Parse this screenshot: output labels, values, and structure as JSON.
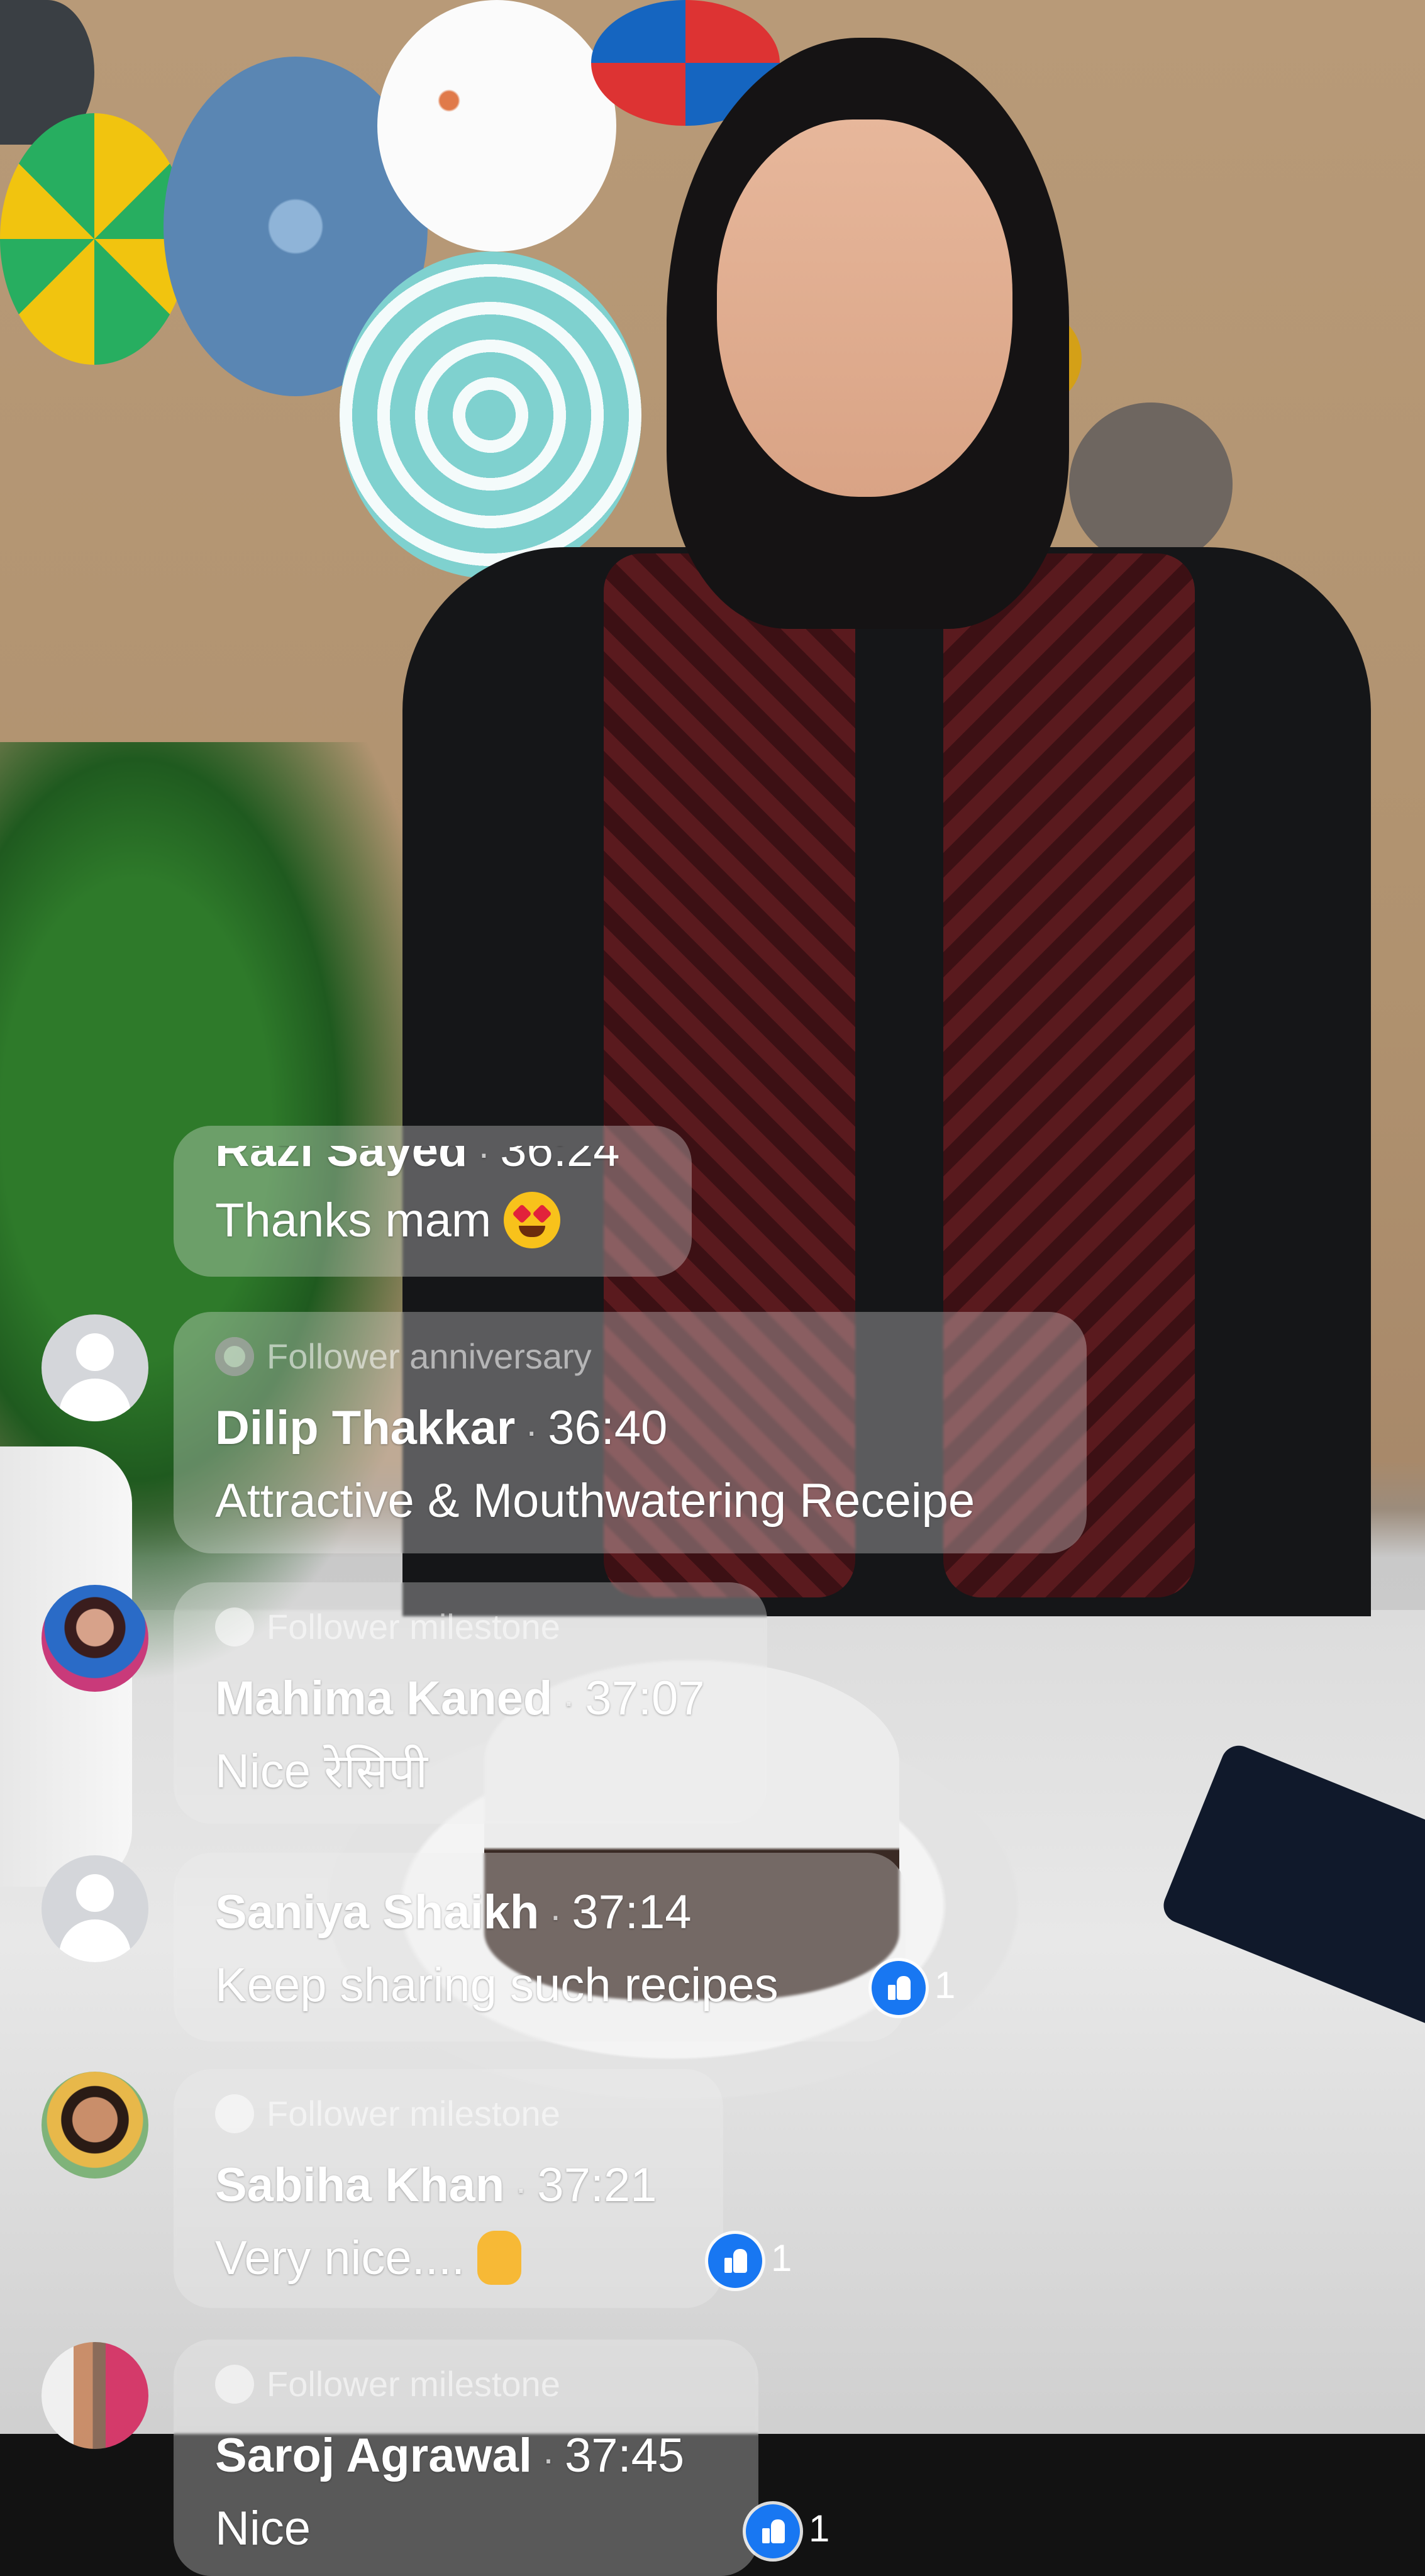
{
  "comments": [
    {
      "name": "Razi Sayed",
      "time": "36:24",
      "text": "Thanks mam",
      "emoji": "smiling-face-with-heart-eyes",
      "badge": null,
      "avatar": "default",
      "likes": null
    },
    {
      "name": "Dilip Thakkar",
      "time": "36:40",
      "text": "Attractive & Mouthwatering Receipe",
      "badge": "Follower anniversary",
      "avatar": "default",
      "likes": null
    },
    {
      "name": "Mahima Kaned",
      "time": "37:07",
      "text": "Nice रेसिपी",
      "badge": "Follower milestone",
      "avatar": "photo",
      "likes": null
    },
    {
      "name": "Saniya Shaikh",
      "time": "37:14",
      "text": "Keep sharing such recipes",
      "badge": null,
      "avatar": "default",
      "likes": "1"
    },
    {
      "name": "Sabiha Khan",
      "time": "37:21",
      "text": "Very nice....",
      "emoji": "thumbs-up",
      "badge": "Follower milestone",
      "avatar": "photo",
      "likes": "1"
    },
    {
      "name": "Saroj Agrawal",
      "time": "37:45",
      "text": "Nice",
      "badge": "Follower milestone",
      "avatar": "photo",
      "likes": "1"
    }
  ],
  "separator": "·",
  "colors": {
    "like_blue": "#1877f2",
    "bubble": "rgba(238,238,240,0.32)",
    "text": "#ffffff"
  }
}
